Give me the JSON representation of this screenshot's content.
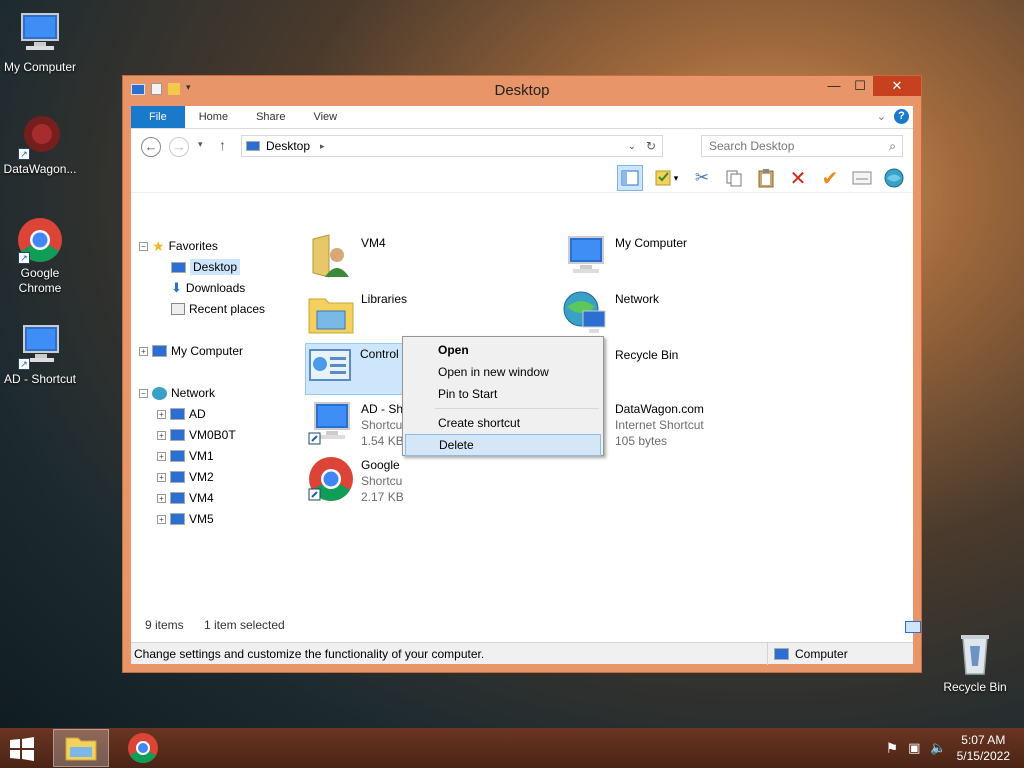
{
  "desktop": {
    "icons": [
      {
        "label": "My Computer"
      },
      {
        "label": "DataWagon..."
      },
      {
        "label": "Google Chrome"
      },
      {
        "label": "AD - Shortcut"
      },
      {
        "label": "Recycle Bin"
      }
    ]
  },
  "window": {
    "title": "Desktop",
    "tabs": [
      "File",
      "Home",
      "Share",
      "View"
    ],
    "address": "Desktop",
    "search_placeholder": "Search Desktop",
    "help": "?"
  },
  "navpane": {
    "favorites": "Favorites",
    "desktop": "Desktop",
    "downloads": "Downloads",
    "recent": "Recent places",
    "my_computer": "My Computer",
    "network": "Network",
    "network_items": [
      "AD",
      "VM0B0T",
      "VM1",
      "VM2",
      "VM4",
      "VM5"
    ]
  },
  "items": [
    {
      "name": "VM4"
    },
    {
      "name": "My Computer"
    },
    {
      "name": "Libraries"
    },
    {
      "name": "Network"
    },
    {
      "name": "Control"
    },
    {
      "name": "Recycle Bin"
    },
    {
      "name": "AD - Sh",
      "type": "Shortcu",
      "size": "1.54 KB"
    },
    {
      "name": "DataWagon.com",
      "type": "Internet Shortcut",
      "size": "105 bytes"
    },
    {
      "name": "Google",
      "type": "Shortcu",
      "size": "2.17 KB"
    }
  ],
  "context_menu": {
    "open": "Open",
    "open_new": "Open in new window",
    "pin": "Pin to Start",
    "create_shortcut": "Create shortcut",
    "delete": "Delete"
  },
  "status": {
    "count": "9 items",
    "selected": "1 item selected",
    "info": "Change settings and customize the functionality of your computer.",
    "location": "Computer"
  },
  "taskbar": {
    "time": "5:07 AM",
    "date": "5/15/2022"
  },
  "colors": {
    "accent": "#1979ca",
    "window_frame": "#e8956a",
    "close_button": "#c7401f",
    "selection": "#cde6fb"
  }
}
